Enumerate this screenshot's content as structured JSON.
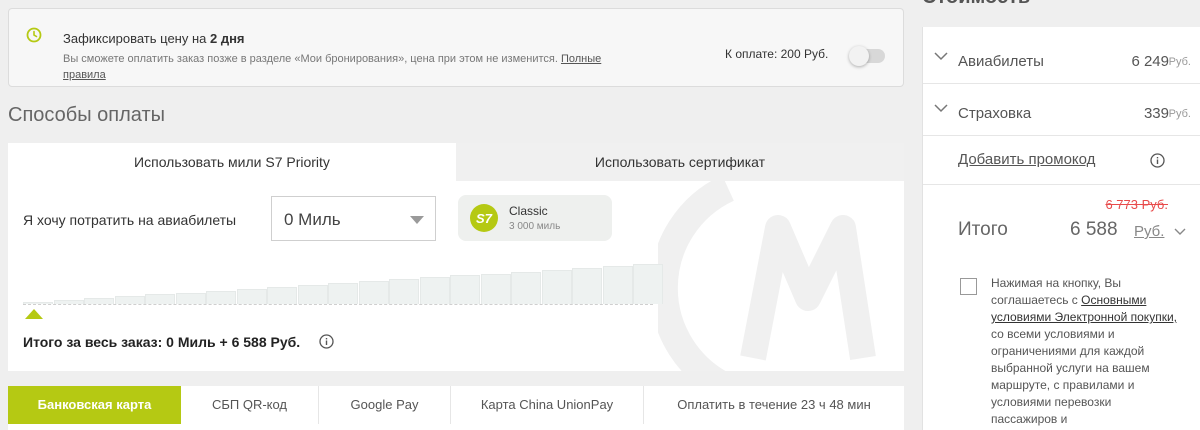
{
  "fix_price": {
    "title_prefix": "Зафиксировать цену на ",
    "title_bold": "2 дня",
    "description": "Вы сможете оплатить заказ позже в разделе «Мои бронирования», цена при этом не изменится.",
    "rules_link": "Полные правила",
    "amount_label": "К оплате: 200 Руб.",
    "toggle_on": false,
    "accent_color": "#b5c913"
  },
  "payment_methods": {
    "title": "Способы оплаты"
  },
  "miles_tabs": [
    {
      "label": "Использовать мили S7 Priority",
      "active": true
    },
    {
      "label": "Использовать сертификат",
      "active": false
    }
  ],
  "miles": {
    "spend_label": "Я хочу потратить на авиабилеты",
    "selected_value": "0 Миль",
    "tier": {
      "logo_text": "S7",
      "name": "Classic",
      "miles": "3 000 миль"
    },
    "slider_level": 0,
    "total": "Итого за весь заказ: 0 Миль + 6 588 Руб."
  },
  "pay_tabs": [
    {
      "label": "Банковская карта",
      "active": true
    },
    {
      "label": "СБП QR-код",
      "active": false
    },
    {
      "label": "Google Pay",
      "active": false
    },
    {
      "label": "Карта China UnionPay",
      "active": false
    },
    {
      "label": "Оплатить в течение 23 ч 48 мин",
      "active": false
    }
  ],
  "cost": {
    "heading": "Стоимость",
    "rows": [
      {
        "label": "Авиабилеты",
        "amount": "6 249",
        "currency": "Руб."
      },
      {
        "label": "Страховка",
        "amount": "339",
        "currency": "Руб."
      }
    ],
    "promo_link": "Добавить промокод",
    "old_total": "6 773 Руб.",
    "total_label": "Итого",
    "total_amount": "6 588",
    "total_currency": "Руб.",
    "agree_prefix": "Нажимая на кнопку, Вы соглашаетесь с ",
    "agree_link": "Основными условиями Электронной покупки,",
    "agree_suffix": " со всеми условиями и ограничениями для каждой выбранной услуги на вашем маршруте, с правилами и условиями перевозки пассажиров и"
  }
}
